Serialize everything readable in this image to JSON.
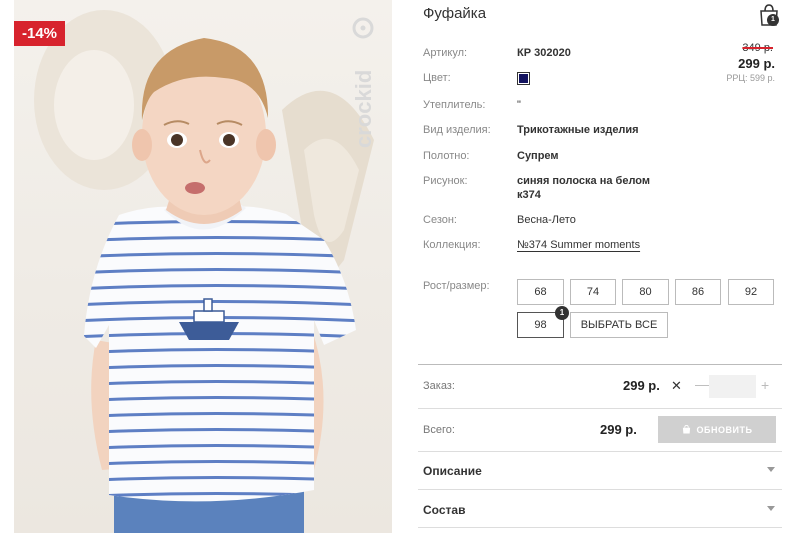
{
  "product": {
    "discount_badge": "-14%",
    "brand_logo": "crockid",
    "title": "Фуфайка",
    "cart_count": "1",
    "pricing": {
      "old_price": "349 р.",
      "price": "299 р.",
      "rrc": "РРЦ: 599 р."
    },
    "attributes": [
      {
        "label": "Артикул:",
        "value": "КР 302020"
      },
      {
        "label": "Цвет:",
        "value": ""
      },
      {
        "label": "Утеплитель:",
        "value": "\""
      },
      {
        "label": "Вид изделия:",
        "value": "Трикотажные изделия"
      },
      {
        "label": "Полотно:",
        "value": "Супрем"
      },
      {
        "label": "Рисунок:",
        "value": "синяя полоска на белом",
        "value2": "к374"
      },
      {
        "label": "Сезон:",
        "value": "Весна-Лето"
      },
      {
        "label": "Коллекция:",
        "value": "№374 Summer moments"
      }
    ],
    "color_swatch": "#12125e",
    "size_label": "Рост/размер:",
    "sizes": [
      "68",
      "74",
      "80",
      "86",
      "92",
      "98"
    ],
    "select_all_label": "ВЫБРАТЬ ВСЕ",
    "selected_size_badge": "1",
    "order": {
      "label": "Заказ:",
      "price": "299 р.",
      "times": "✕",
      "minus": "—",
      "plus": "+",
      "qty": ""
    },
    "total": {
      "label": "Всего:",
      "price": "299 р.",
      "update_label": "ОБНОВИТЬ"
    },
    "accordions": [
      "Описание",
      "Состав"
    ]
  }
}
